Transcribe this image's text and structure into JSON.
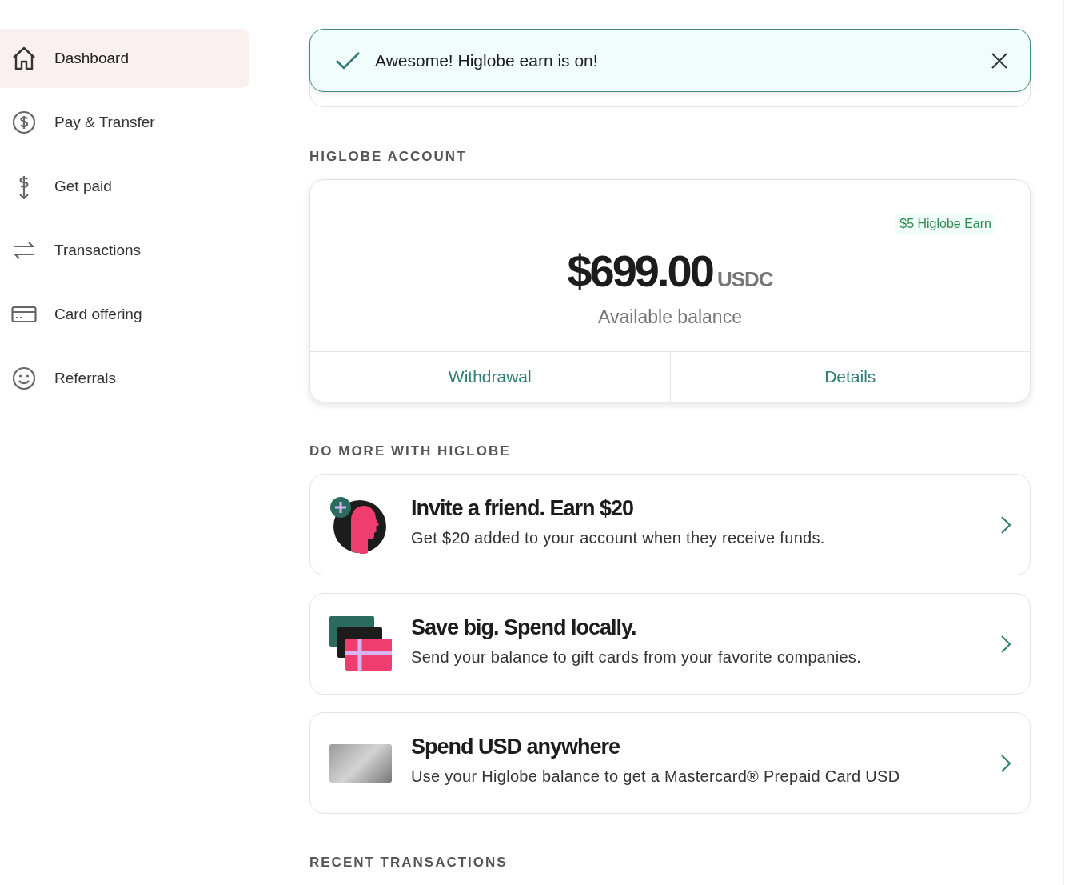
{
  "sidebar": {
    "items": [
      {
        "label": "Dashboard",
        "selected": true
      },
      {
        "label": "Pay & Transfer",
        "selected": false
      },
      {
        "label": "Get paid",
        "selected": false
      },
      {
        "label": "Transactions",
        "selected": false
      },
      {
        "label": "Card offering",
        "selected": false
      },
      {
        "label": "Referrals",
        "selected": false
      }
    ]
  },
  "toast": {
    "message": "Awesome! Higlobe earn is on!"
  },
  "account": {
    "heading": "HIGLOBE ACCOUNT",
    "badge": "$5 Higlobe Earn",
    "amount": "$699.00",
    "currency": "USDC",
    "caption": "Available balance",
    "actions": [
      "Withdrawal",
      "Details"
    ]
  },
  "offers": {
    "heading": "DO MORE WITH HIGLOBE",
    "items": [
      {
        "title": "Invite a friend. Earn $20",
        "text": "Get $20 added to your account when they receive funds."
      },
      {
        "title": "Save big. Spend locally.",
        "text": "Send your balance to gift cards from your favorite companies."
      },
      {
        "title": "Spend USD anywhere",
        "text": "Use your Higlobe balance to get a Mastercard® Prepaid Card USD"
      }
    ]
  },
  "recent": {
    "heading": "RECENT TRANSACTIONS"
  }
}
